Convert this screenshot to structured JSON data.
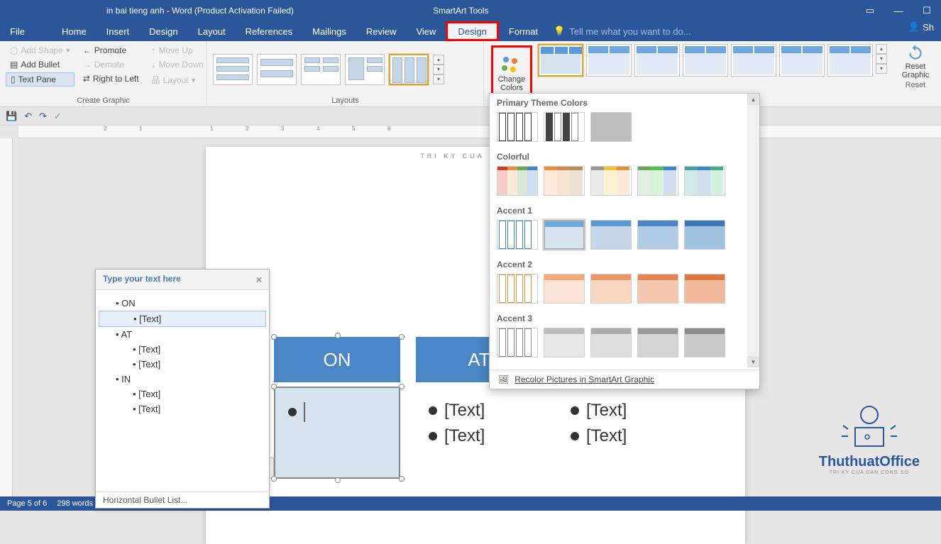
{
  "titlebar": {
    "doc_title": "in bai tieng anh - Word (Product Activation Failed)",
    "tools_title": "SmartArt Tools"
  },
  "tabs": {
    "file": "File",
    "home": "Home",
    "insert": "Insert",
    "design1": "Design",
    "layout": "Layout",
    "references": "References",
    "mailings": "Mailings",
    "review": "Review",
    "view": "View",
    "design2": "Design",
    "format": "Format",
    "tellme": "Tell me what you want to do...",
    "share": "Sh"
  },
  "ribbon": {
    "create_graphic": {
      "add_shape": "Add Shape",
      "add_bullet": "Add Bullet",
      "text_pane": "Text Pane",
      "promote": "Promote",
      "demote": "Demote",
      "rtl": "Right to Left",
      "move_up": "Move Up",
      "move_down": "Move Down",
      "layout_btn": "Layout",
      "label": "Create Graphic"
    },
    "layouts_label": "Layouts",
    "change_colors": "Change Colors",
    "reset_graphic": "Reset Graphic",
    "reset_label": "Reset"
  },
  "color_dropdown": {
    "primary": "Primary Theme Colors",
    "colorful": "Colorful",
    "accent1": "Accent 1",
    "accent2": "Accent 2",
    "accent3": "Accent 3",
    "recolor": "Recolor Pictures in SmartArt Graphic"
  },
  "text_pane": {
    "title": "Type your text here",
    "items": [
      "ON",
      "[Text]",
      "AT",
      "[Text]",
      "[Text]",
      "IN",
      "[Text]",
      "[Text]"
    ],
    "footer": "Horizontal Bullet List..."
  },
  "smartart": {
    "headers": [
      "ON",
      "AT"
    ],
    "cells": [
      "[Text]",
      "[Text]",
      "[Text]",
      "[Text]"
    ]
  },
  "page_header": "TRI KY CUA DAN CO",
  "status": {
    "page": "Page 5 of 6",
    "words": "298 words"
  },
  "watermark": {
    "brand": "ThuthuatOffice",
    "tag": "TRI KY CUA DAN CONG SO"
  }
}
